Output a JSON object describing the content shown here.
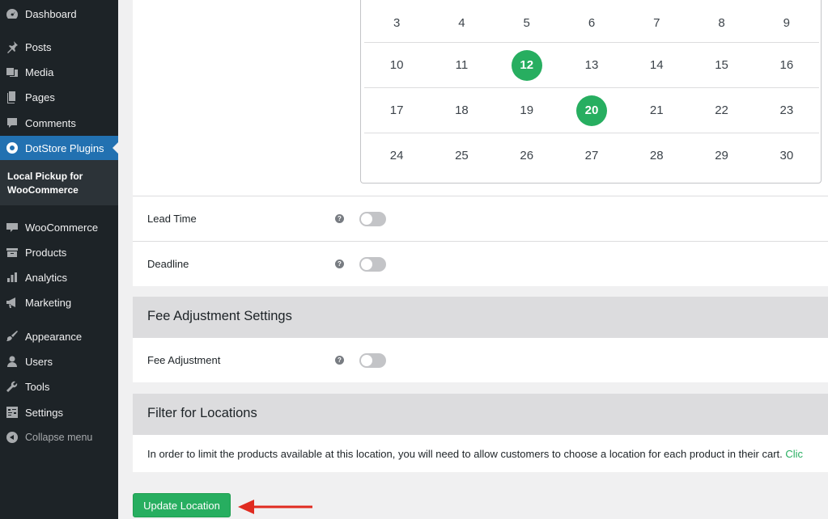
{
  "sidebar": {
    "items": [
      {
        "label": "Dashboard",
        "icon": "dashboard-icon"
      },
      {
        "label": "Posts",
        "icon": "pin-icon"
      },
      {
        "label": "Media",
        "icon": "media-icon"
      },
      {
        "label": "Pages",
        "icon": "pages-icon"
      },
      {
        "label": "Comments",
        "icon": "comment-icon"
      },
      {
        "label": "DotStore Plugins",
        "icon": "dotstore-icon",
        "active": true
      },
      {
        "label": "WooCommerce",
        "icon": "woo-icon"
      },
      {
        "label": "Products",
        "icon": "products-icon"
      },
      {
        "label": "Analytics",
        "icon": "analytics-icon"
      },
      {
        "label": "Marketing",
        "icon": "megaphone-icon"
      },
      {
        "label": "Appearance",
        "icon": "brush-icon"
      },
      {
        "label": "Users",
        "icon": "user-icon"
      },
      {
        "label": "Tools",
        "icon": "wrench-icon"
      },
      {
        "label": "Settings",
        "icon": "settings-icon"
      }
    ],
    "submenu_label": "Local Pickup for WooCommerce",
    "collapse_label": "Collapse menu"
  },
  "calendar": {
    "rows": [
      [
        "3",
        "4",
        "5",
        "6",
        "7",
        "8",
        "9"
      ],
      [
        "10",
        "11",
        "12",
        "13",
        "14",
        "15",
        "16"
      ],
      [
        "17",
        "18",
        "19",
        "20",
        "21",
        "22",
        "23"
      ],
      [
        "24",
        "25",
        "26",
        "27",
        "28",
        "29",
        "30"
      ]
    ],
    "selected": [
      "12",
      "20"
    ],
    "selected_color": "#27ae60"
  },
  "settings_rows": {
    "lead_time": "Lead Time",
    "deadline": "Deadline"
  },
  "fee_section": {
    "title": "Fee Adjustment Settings",
    "fee_adjustment": "Fee Adjustment"
  },
  "filter_section": {
    "title": "Filter for Locations",
    "text": "In order to limit the products available at this location, you will need to allow customers to choose a location for each product in their cart.",
    "link_text": "Clic"
  },
  "help_icon_char": "?",
  "update_button": "Update Location",
  "colors": {
    "accent": "#27ae60",
    "sidebar_bg": "#1d2327",
    "active_menu": "#2271b1",
    "arrow": "#e02b20"
  }
}
